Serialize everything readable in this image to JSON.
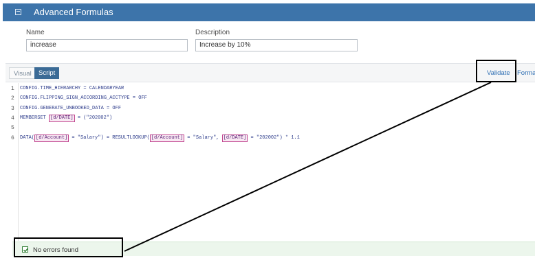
{
  "dialog": {
    "title": "Advanced Formulas",
    "title_icon": "window-icon"
  },
  "form": {
    "name_label": "Name",
    "name_value": "increase",
    "description_label": "Description",
    "description_value": "Increase by 10%"
  },
  "tabs": {
    "visual": "Visual",
    "script": "Script",
    "active": "Script"
  },
  "toolbar": {
    "validate": "Validate",
    "format": "Format"
  },
  "code": {
    "lines": [
      {
        "num": "1",
        "text": "CONFIG.TIME_HIERARCHY = CALENDARYEAR"
      },
      {
        "num": "2",
        "text": "CONFIG.FLIPPING_SIGN_ACCORDING_ACCTYPE = OFF"
      },
      {
        "num": "3",
        "text": "CONFIG.GENERATE_UNBOOKED_DATA = OFF"
      },
      {
        "num": "4",
        "pre": "MEMBERSET ",
        "token": "[d/DATE]",
        "post": " = (\"202002\")"
      },
      {
        "num": "5",
        "text": ""
      },
      {
        "num": "6",
        "p0": "DATA(",
        "t1": "[d/Account]",
        "p1": " = \"Salary\") = RESULTLOOKUP(",
        "t2": "[d/Account]",
        "p2": " = \"Salary\", ",
        "t3": "[d/DATE]",
        "p3": " = \"202002\") * 1.1"
      }
    ]
  },
  "status": {
    "message": "No errors found",
    "icon": "checkbox-check-icon",
    "color": "#2e7d32"
  },
  "colors": {
    "header": "#3d74aa",
    "accent": "#3b6b96",
    "link": "#2d6eb3",
    "token_border": "#c0438e"
  }
}
